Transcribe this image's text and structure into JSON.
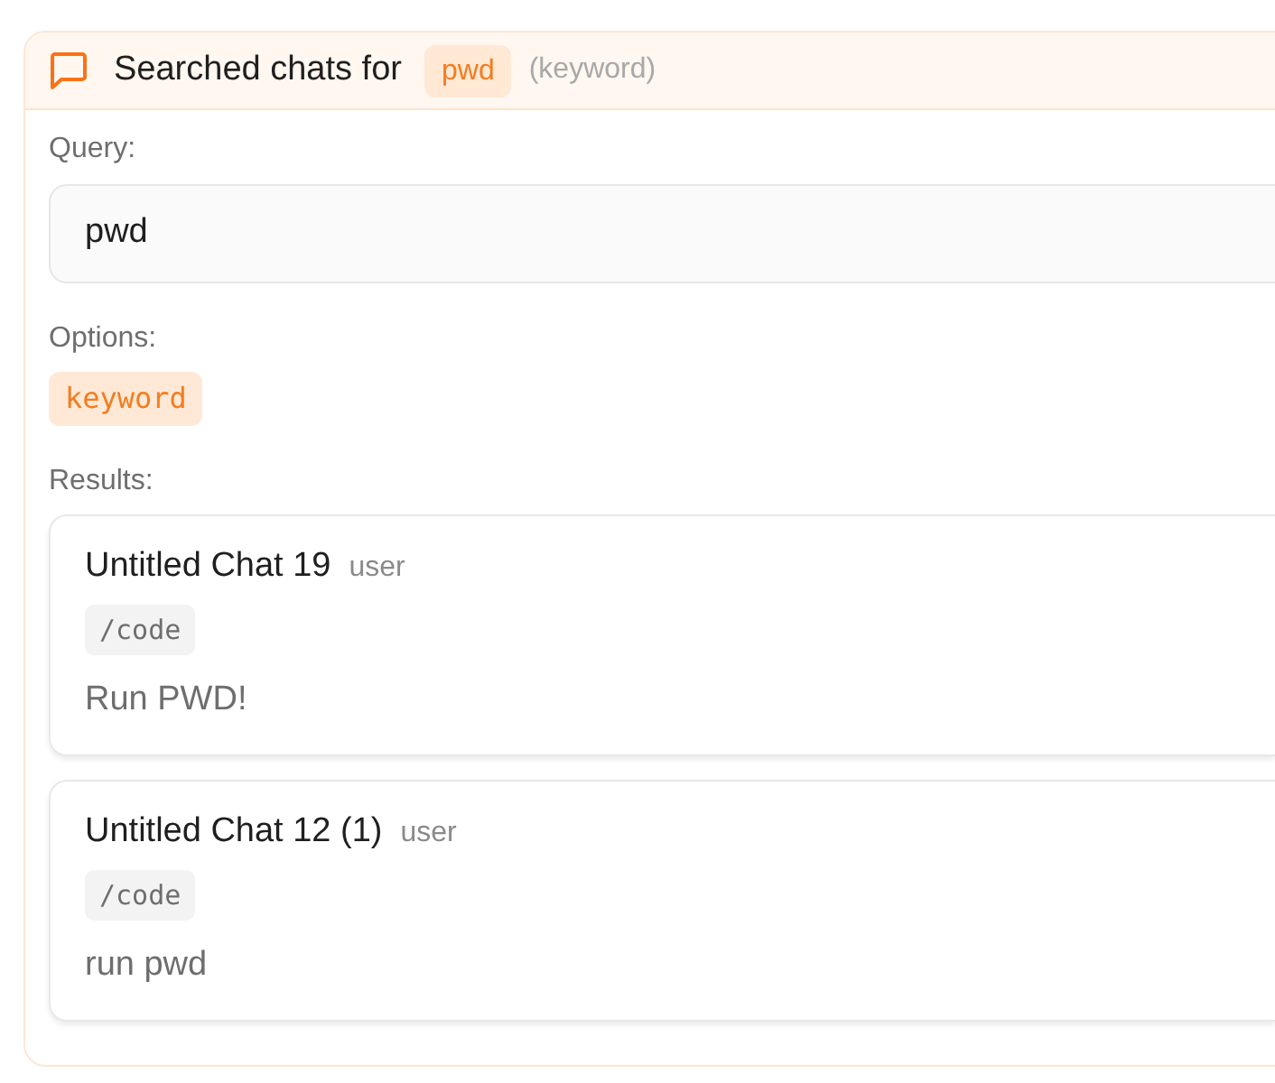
{
  "header": {
    "title": "Searched chats for",
    "query_badge": "pwd",
    "mode": "(keyword)"
  },
  "query": {
    "label": "Query:",
    "value": "pwd"
  },
  "options": {
    "label": "Options:",
    "tags": [
      "keyword"
    ]
  },
  "results": {
    "label": "Results:",
    "items": [
      {
        "title": "Untitled Chat 19",
        "role": "user",
        "command": "/code",
        "message": "Run PWD!"
      },
      {
        "title": "Untitled Chat 12 (1)",
        "role": "user",
        "command": "/code",
        "message": "run pwd"
      }
    ]
  }
}
